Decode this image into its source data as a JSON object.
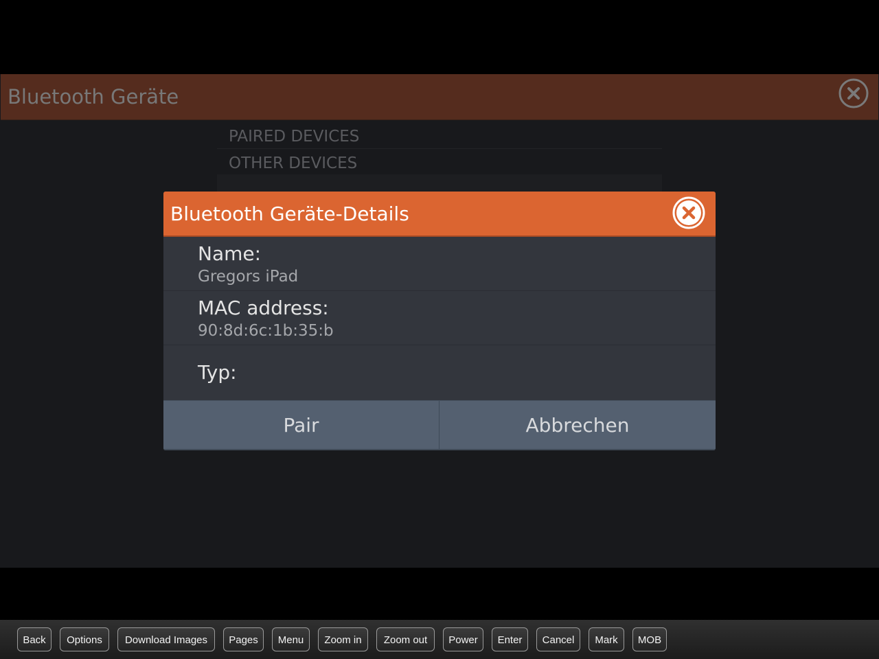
{
  "background_window": {
    "title": "Bluetooth Geräte",
    "close_icon": "circle-x-icon",
    "list_items": [
      "PAIRED DEVICES",
      "OTHER DEVICES"
    ]
  },
  "dialog": {
    "title": "Bluetooth Geräte-Details",
    "close_icon": "circle-x-icon",
    "fields": [
      {
        "label": "Name:",
        "value": "Gregors iPad"
      },
      {
        "label": "MAC address:",
        "value": "90:8d:6c:1b:35:b"
      },
      {
        "label": "Typ:",
        "value": ""
      }
    ],
    "buttons": {
      "pair": "Pair",
      "cancel": "Abbrechen"
    }
  },
  "toolbar": {
    "buttons": [
      "Back",
      "Options",
      "Download Images",
      "Pages",
      "Menu",
      "Zoom in",
      "Zoom out",
      "Power",
      "Enter",
      "Cancel",
      "Mark",
      "MOB"
    ]
  },
  "colors": {
    "dialog_header": "#db6531",
    "background_header": "#552c1e",
    "dialog_body": "#33363d",
    "dialog_buttons": "#546070"
  }
}
